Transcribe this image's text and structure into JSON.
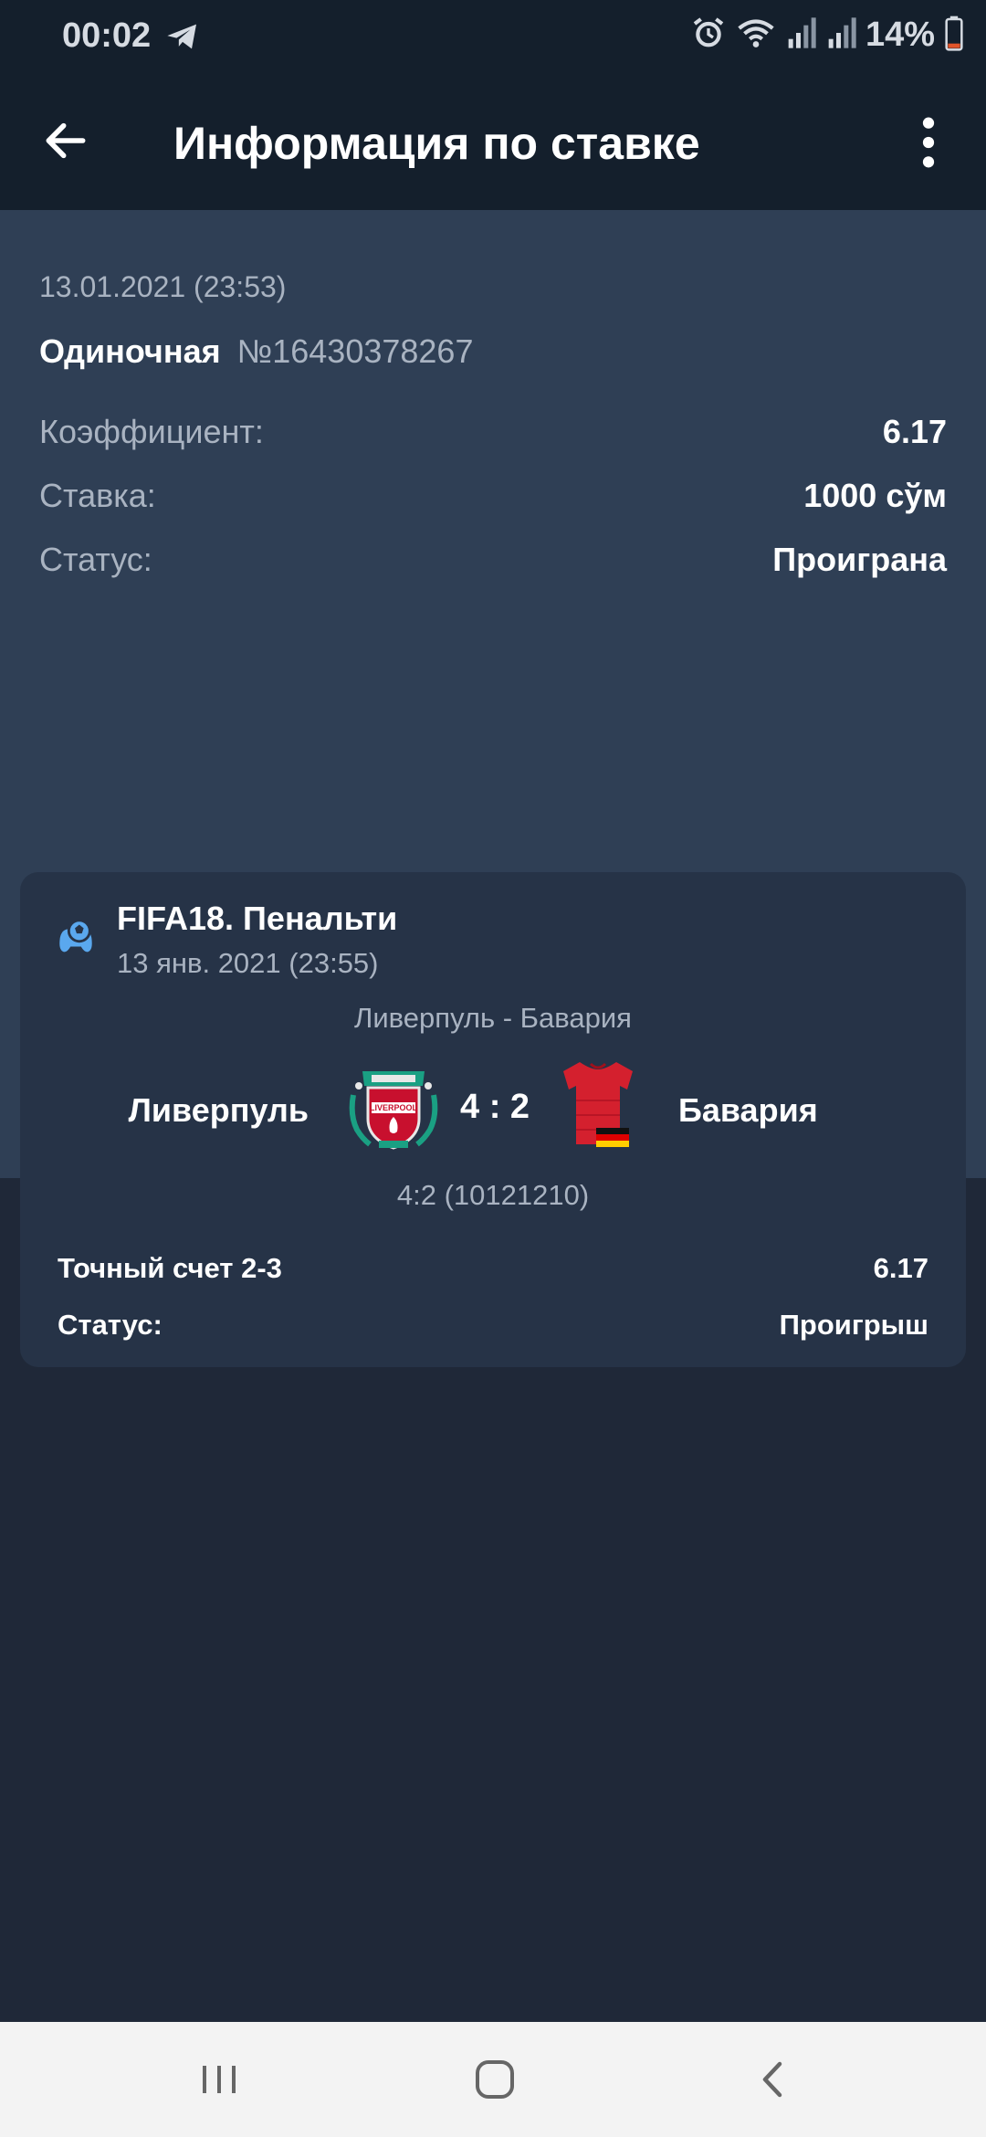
{
  "status_bar": {
    "time": "00:02",
    "battery": "14%",
    "icons": [
      "telegram-icon",
      "alarm-icon",
      "wifi-icon",
      "signal-icon",
      "signal-icon",
      "battery-icon"
    ]
  },
  "app_bar": {
    "title": "Информация по ставке",
    "back_icon": "arrow-left-icon",
    "menu_icon": "more-vert-icon"
  },
  "bet": {
    "datetime": "13.01.2021 (23:53)",
    "type": "Одиночная",
    "number": "№16430378267",
    "rows": [
      {
        "label": "Коэффициент:",
        "value": "6.17"
      },
      {
        "label": "Ставка:",
        "value": "1000 сўм"
      },
      {
        "label": "Статус:",
        "value": "Проиграна"
      }
    ]
  },
  "event": {
    "sport_icon": "gamepad-ball-icon",
    "league": "FIFA18. Пенальти",
    "date": "13 янв. 2021 (23:55)",
    "match": "Ливерпуль - Бавария",
    "team1": "Ливерпуль",
    "team1_logo": "liverpool-crest",
    "score": "4 : 2",
    "team2": "Бавария",
    "team2_logo": "red-jersey-with-german-flag",
    "detail_score": "4:2 (10121210)",
    "pick_label": "Точный счет 2-3",
    "pick_odds": "6.17",
    "status_label": "Статус:",
    "status_value": "Проигрыш"
  },
  "nav_bar": {
    "buttons": [
      "recent-apps-icon",
      "home-icon",
      "back-icon"
    ]
  },
  "colors": {
    "status_bar_bg": "#141f2c",
    "summary_bg": "#2f3f55",
    "card_bg": "#263347",
    "page_bg": "#1f2838",
    "muted_text": "#a9b3c1",
    "sport_icon": "#5aa8ee"
  }
}
